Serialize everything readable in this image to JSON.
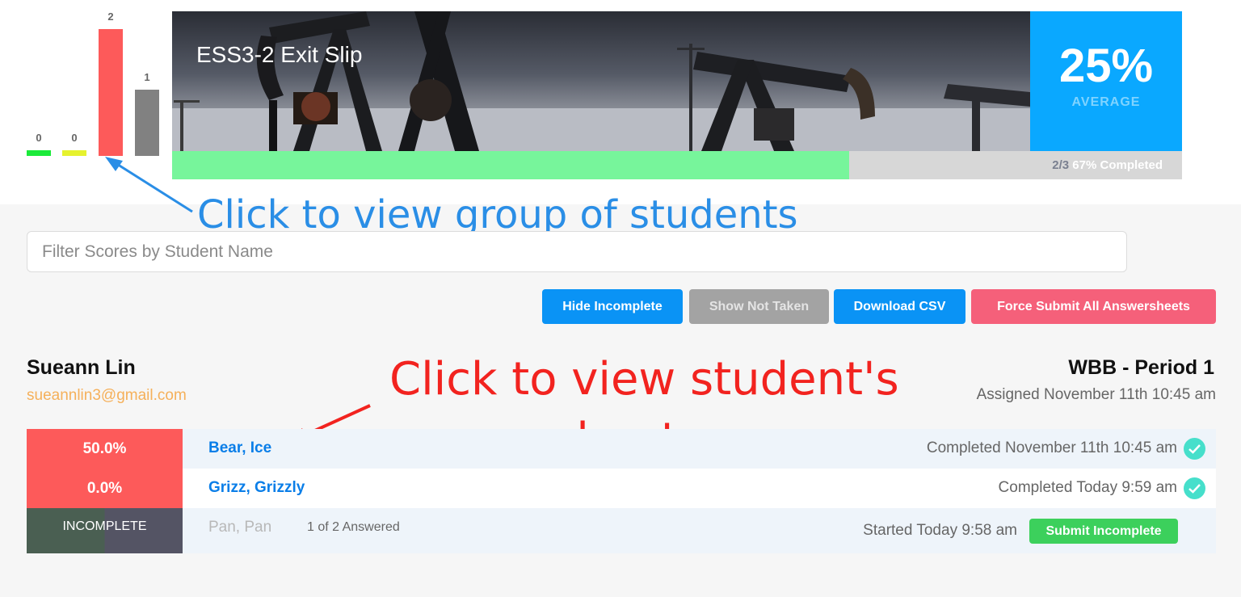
{
  "histogram": {
    "bars": [
      {
        "label": "0",
        "value": 0,
        "color": "#1bea3a"
      },
      {
        "label": "0",
        "value": 0,
        "color": "#e6f22e"
      },
      {
        "label": "2",
        "value": 2,
        "color": "#fd5a5a"
      },
      {
        "label": "1",
        "value": 1,
        "color": "#818181"
      }
    ]
  },
  "banner": {
    "title": "ESS3-2 Exit Slip",
    "average_value": "25%",
    "average_label": "AVERAGE",
    "progress_fraction": "2/3",
    "progress_text": "67% Completed",
    "progress_ratio": 0.67
  },
  "annotations": {
    "group": "Click to view group of students",
    "student": "Click to view student's answersheet"
  },
  "filter": {
    "placeholder": "Filter Scores by Student Name"
  },
  "buttons": {
    "hide_incomplete": "Hide Incomplete",
    "show_not_taken": "Show Not Taken",
    "download_csv": "Download CSV",
    "force_submit": "Force Submit All Answersheets"
  },
  "student": {
    "name": "Sueann Lin",
    "email": "sueannlin3@gmail.com",
    "period": "WBB - Period 1",
    "assigned": "Assigned November 11th 10:45 am"
  },
  "rows": [
    {
      "score": "50.0%",
      "name": "Bear, Ice",
      "status": "Completed November 11th 10:45 am"
    },
    {
      "score": "0.0%",
      "name": "Grizz, Grizzly",
      "status": "Completed Today 9:59 am"
    },
    {
      "score": "INCOMPLETE",
      "name": "Pan, Pan",
      "answered": "1 of 2 Answered",
      "status": "Started Today 9:58 am",
      "action": "Submit Incomplete"
    }
  ],
  "colors": {
    "primary": "#0a93f5",
    "average": "#0aa8ff",
    "score_bad": "#fd5a5a",
    "incomplete": "#4d5a55",
    "success": "#3cd05c"
  }
}
